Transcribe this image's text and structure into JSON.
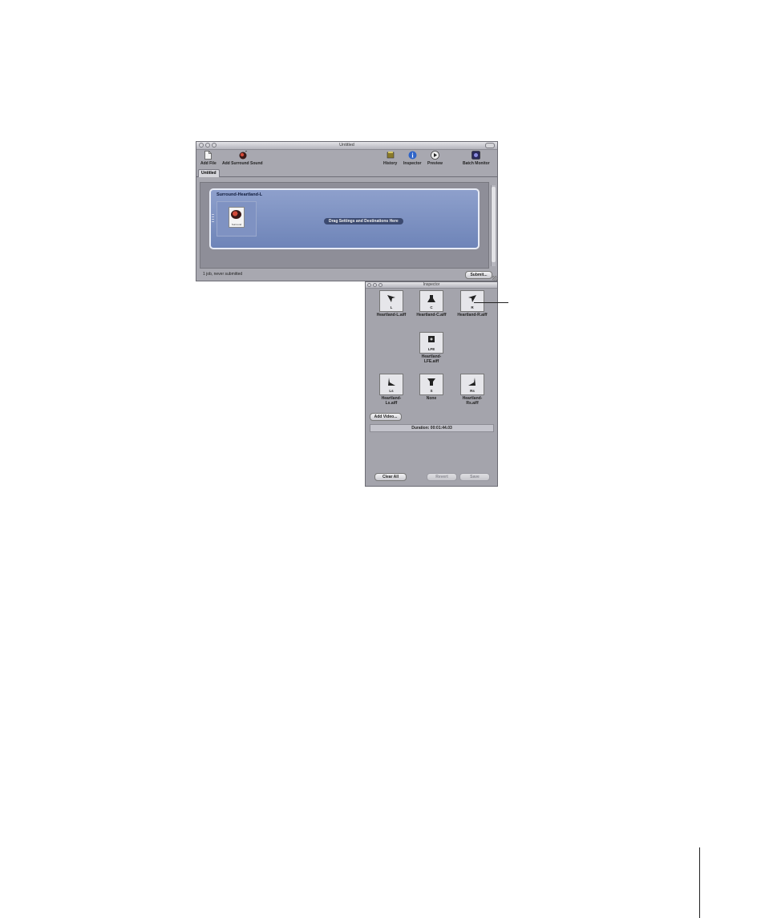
{
  "main_window": {
    "title": "Untitled",
    "toolbar": {
      "add_file": "Add File",
      "add_surround_sound": "Add Surround Sound",
      "history": "History",
      "inspector": "Inspector",
      "preview": "Preview",
      "batch_monitor": "Batch Monitor"
    },
    "tab": "Untitled",
    "job": {
      "title": "Surround-Heartland-L",
      "source_caption": "Surround",
      "drop_hint": "Drag Settings and Destinations Here"
    },
    "status": "1 job, never submitted",
    "submit_button": "Submit..."
  },
  "inspector_window": {
    "title": "Inspector",
    "speakers": [
      {
        "channel": "L",
        "file": "Heartland-L.aiff",
        "icon": "speaker-left-icon"
      },
      {
        "channel": "C",
        "file": "Heartland-C.aiff",
        "icon": "speaker-center-icon"
      },
      {
        "channel": "R",
        "file": "Heartland-R.aiff",
        "icon": "speaker-right-icon"
      },
      {
        "channel": "LFE",
        "file": "Heartland-LFE.aiff",
        "icon": "subwoofer-icon"
      },
      {
        "channel": "Ls",
        "file": "Heartland-Ls.aiff",
        "icon": "speaker-left-surround-icon"
      },
      {
        "channel": "S",
        "file": "None",
        "icon": "speaker-surround-icon"
      },
      {
        "channel": "Rs",
        "file": "Heartland-Rs.aiff",
        "icon": "speaker-right-surround-icon"
      }
    ],
    "add_video_button": "Add Video...",
    "duration": "Duration: 00:01:44.03",
    "clear_all_button": "Clear All",
    "revert_button": "Revert",
    "save_button": "Save"
  }
}
